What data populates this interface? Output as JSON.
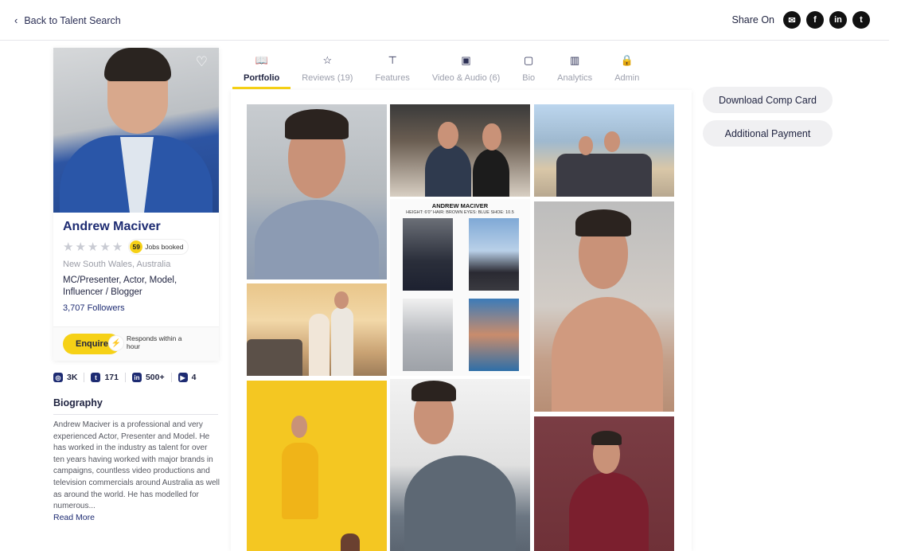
{
  "header": {
    "back_label": "Back to Talent Search",
    "share_label": "Share On",
    "share_icons": [
      "email-icon",
      "facebook-icon",
      "linkedin-icon",
      "twitter-icon"
    ]
  },
  "profile": {
    "name": "Andrew Maciver",
    "rating_stars": 5,
    "jobs_booked_count": "59",
    "jobs_booked_label": "Jobs booked",
    "location": "New South Wales, Australia",
    "roles": "MC/Presenter, Actor, Model, Influencer / Blogger",
    "followers": "3,707 Followers",
    "enquire_label": "Enquire",
    "responds_text": "Responds within a hour"
  },
  "socials": [
    {
      "icon": "instagram-icon",
      "count": "3K"
    },
    {
      "icon": "twitter-icon",
      "count": "171"
    },
    {
      "icon": "linkedin-icon",
      "count": "500+"
    },
    {
      "icon": "youtube-icon",
      "count": "4"
    }
  ],
  "biography": {
    "title": "Biography",
    "text": "Andrew Maciver is a professional and very experienced Actor, Presenter and Model. He has worked in the industry as talent for over ten years having worked with major brands in campaigns, countless video productions and television commercials around Australia as well as around the world. He has modelled for numerous...",
    "read_more": "Read More"
  },
  "tabs": [
    {
      "label": "Portfolio",
      "icon": "book-icon",
      "active": true
    },
    {
      "label": "Reviews (19)",
      "icon": "star-icon",
      "active": false
    },
    {
      "label": "Features",
      "icon": "shirt-icon",
      "active": false
    },
    {
      "label": "Video & Audio (6)",
      "icon": "video-icon",
      "active": false
    },
    {
      "label": "Bio",
      "icon": "id-card-icon",
      "active": false
    },
    {
      "label": "Analytics",
      "icon": "bar-chart-icon",
      "active": false
    },
    {
      "label": "Admin",
      "icon": "lock-icon",
      "active": false
    }
  ],
  "comp_card": {
    "name": "ANDREW MACIVER",
    "stats": "HEIGHT: 6'0\"   HAIR: BROWN   EYES: BLUE   SHOE: 10.5"
  },
  "actions": {
    "download_comp_card": "Download Comp Card",
    "additional_payment": "Additional Payment"
  },
  "colors": {
    "accent": "#f6d116",
    "brand_navy": "#1d2b72",
    "button_gray": "#f0f0f2"
  }
}
